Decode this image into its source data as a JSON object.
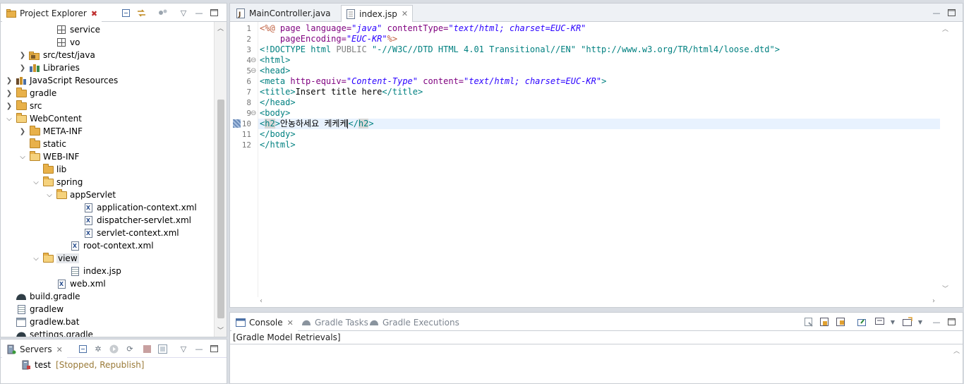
{
  "project_explorer": {
    "title": "Project Explorer",
    "items": [
      {
        "label": "service",
        "depth": 4,
        "icon": "package-icon",
        "arrow": ""
      },
      {
        "label": "vo",
        "depth": 4,
        "icon": "package-icon",
        "arrow": ""
      },
      {
        "label": "src/test/java",
        "depth": 2,
        "icon": "source-folder-icon",
        "arrow": "›"
      },
      {
        "label": "Libraries",
        "depth": 2,
        "icon": "libraries-icon",
        "arrow": "›"
      },
      {
        "label": "JavaScript Resources",
        "depth": 1,
        "icon": "js-resources-icon",
        "arrow": "›"
      },
      {
        "label": "gradle",
        "depth": 1,
        "icon": "folder-icon",
        "arrow": "›"
      },
      {
        "label": "src",
        "depth": 1,
        "icon": "folder-icon",
        "arrow": "›"
      },
      {
        "label": "WebContent",
        "depth": 1,
        "icon": "folder-open-icon",
        "arrow": "⌄"
      },
      {
        "label": "META-INF",
        "depth": 2,
        "icon": "folder-icon",
        "arrow": "›"
      },
      {
        "label": "static",
        "depth": 2,
        "icon": "folder-icon",
        "arrow": ""
      },
      {
        "label": "WEB-INF",
        "depth": 2,
        "icon": "folder-open-icon",
        "arrow": "⌄"
      },
      {
        "label": "lib",
        "depth": 3,
        "icon": "folder-icon",
        "arrow": ""
      },
      {
        "label": "spring",
        "depth": 3,
        "icon": "folder-open-icon",
        "arrow": "⌄"
      },
      {
        "label": "appServlet",
        "depth": 4,
        "icon": "folder-open-icon",
        "arrow": "⌄"
      },
      {
        "label": "application-context.xml",
        "depth": 6,
        "icon": "xml-file-icon",
        "arrow": ""
      },
      {
        "label": "dispatcher-servlet.xml",
        "depth": 6,
        "icon": "xml-file-icon",
        "arrow": ""
      },
      {
        "label": "servlet-context.xml",
        "depth": 6,
        "icon": "xml-file-icon",
        "arrow": ""
      },
      {
        "label": "root-context.xml",
        "depth": 5,
        "icon": "xml-file-icon",
        "arrow": ""
      },
      {
        "label": "view",
        "depth": 3,
        "icon": "folder-open-icon",
        "arrow": "⌄",
        "selected": true
      },
      {
        "label": "index.jsp",
        "depth": 5,
        "icon": "jsp-file-icon",
        "arrow": ""
      },
      {
        "label": "web.xml",
        "depth": 4,
        "icon": "xml-file-icon",
        "arrow": ""
      },
      {
        "label": "build.gradle",
        "depth": 1,
        "icon": "gradle-icon",
        "arrow": ""
      },
      {
        "label": "gradlew",
        "depth": 1,
        "icon": "text-file-icon",
        "arrow": ""
      },
      {
        "label": "gradlew.bat",
        "depth": 1,
        "icon": "bat-file-icon",
        "arrow": ""
      },
      {
        "label": "settings.gradle",
        "depth": 1,
        "icon": "gradle-icon",
        "arrow": ""
      }
    ]
  },
  "servers": {
    "title": "Servers",
    "entry_name": "test",
    "entry_status": "[Stopped, Republish]"
  },
  "editor": {
    "tabs": [
      {
        "label": "MainController.java",
        "active": false
      },
      {
        "label": "index.jsp",
        "active": true
      }
    ],
    "lines": [
      {
        "n": "1",
        "segs": [
          [
            "<%@ ",
            "#bf5f3f"
          ],
          [
            "page ",
            "#7f007f"
          ],
          [
            "language=",
            "#7f007f"
          ],
          [
            "\"java\"",
            "#2a00ff"
          ],
          [
            " contentType=",
            "#7f007f"
          ],
          [
            "\"text/html; charset=EUC-KR\"",
            "#2a00ff"
          ]
        ]
      },
      {
        "n": "2",
        "segs": [
          [
            "    pageEncoding=",
            "#7f007f"
          ],
          [
            "\"EUC-KR\"",
            "#2a00ff"
          ],
          [
            "%>",
            "#bf5f3f"
          ]
        ]
      },
      {
        "n": "3",
        "segs": [
          [
            "<!DOCTYPE html ",
            "#008080"
          ],
          [
            "PUBLIC ",
            "#7f7f7f"
          ],
          [
            "\"-//W3C//DTD HTML 4.01 Transitional//EN\" \"http://www.w3.org/TR/html4/loose.dtd\">",
            "#008080"
          ]
        ]
      },
      {
        "n": "4",
        "fold": true,
        "segs": [
          [
            "<html>",
            "#008080"
          ]
        ]
      },
      {
        "n": "5",
        "fold": true,
        "segs": [
          [
            "<head>",
            "#008080"
          ]
        ]
      },
      {
        "n": "6",
        "segs": [
          [
            "<meta ",
            "#008080"
          ],
          [
            "http-equiv=",
            "#7f007f"
          ],
          [
            "\"Content-Type\"",
            "#2a00ff"
          ],
          [
            " content=",
            "#7f007f"
          ],
          [
            "\"text/html; charset=EUC-KR\"",
            "#2a00ff"
          ],
          [
            ">",
            "#008080"
          ]
        ]
      },
      {
        "n": "7",
        "segs": [
          [
            "<title>",
            "#008080"
          ],
          [
            "Insert title here",
            "#000000"
          ],
          [
            "</title>",
            "#008080"
          ]
        ]
      },
      {
        "n": "8",
        "segs": [
          [
            "</head>",
            "#008080"
          ]
        ]
      },
      {
        "n": "9",
        "fold": true,
        "segs": [
          [
            "<body>",
            "#008080"
          ]
        ]
      },
      {
        "n": "10",
        "current": true,
        "segs": [
          [
            "<",
            "#008080"
          ],
          [
            "h2",
            "#008080"
          ],
          [
            ">",
            "#008080"
          ],
          [
            "안농하세요 케케케",
            "#000000"
          ],
          [
            "</",
            "#008080"
          ],
          [
            "h2",
            "#008080"
          ],
          [
            ">",
            "#008080"
          ]
        ]
      },
      {
        "n": "11",
        "segs": [
          [
            "</body>",
            "#008080"
          ]
        ]
      },
      {
        "n": "12",
        "segs": [
          [
            "</html>",
            "#008080"
          ]
        ]
      }
    ]
  },
  "console": {
    "tabs": [
      {
        "label": "Console",
        "active": true
      },
      {
        "label": "Gradle Tasks",
        "active": false
      },
      {
        "label": "Gradle Executions",
        "active": false
      }
    ],
    "header": "[Gradle Model Retrievals]"
  }
}
